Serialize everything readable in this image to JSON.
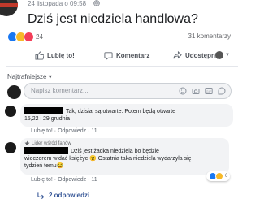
{
  "post": {
    "timestamp": "24 listopada o 09:58 ·",
    "text": "Dziś jest niedziela handlowa?",
    "reaction_count": "24",
    "comment_count": "31 komentarzy"
  },
  "actions": {
    "like": "Lubię to!",
    "comment": "Komentarz",
    "share": "Udostępnij"
  },
  "sort_label": "Najtrafniejsze ▾",
  "composer": {
    "placeholder": "Napisz komentarz..."
  },
  "comments": [
    {
      "text_line1": "Tak, dzisiaj są otwarte. Potem będą otwarte",
      "text_line2": "15,22 i 29 grudnia",
      "like": "Lubię to!",
      "reply": "Odpowiedz",
      "time": "11"
    },
    {
      "badge": "Lider wśród fanów",
      "text_line1": "Dziś jest żadka niedziela bo będzie",
      "text_line2": "wieczorem widać księżyc 😮 Ostatnia taka niedziela wydarzyła się",
      "text_line3": "tydzień temu😂",
      "reaction_count": "6",
      "like": "Lubię to!",
      "reply": "Odpowiedz",
      "time": "11"
    }
  ],
  "replies_link": "2 odpowiedzi",
  "colors": {
    "like_blue": "#1877f2",
    "haha_yellow": "#f7b928",
    "love_red": "#f33e58",
    "link_blue": "#385898"
  }
}
